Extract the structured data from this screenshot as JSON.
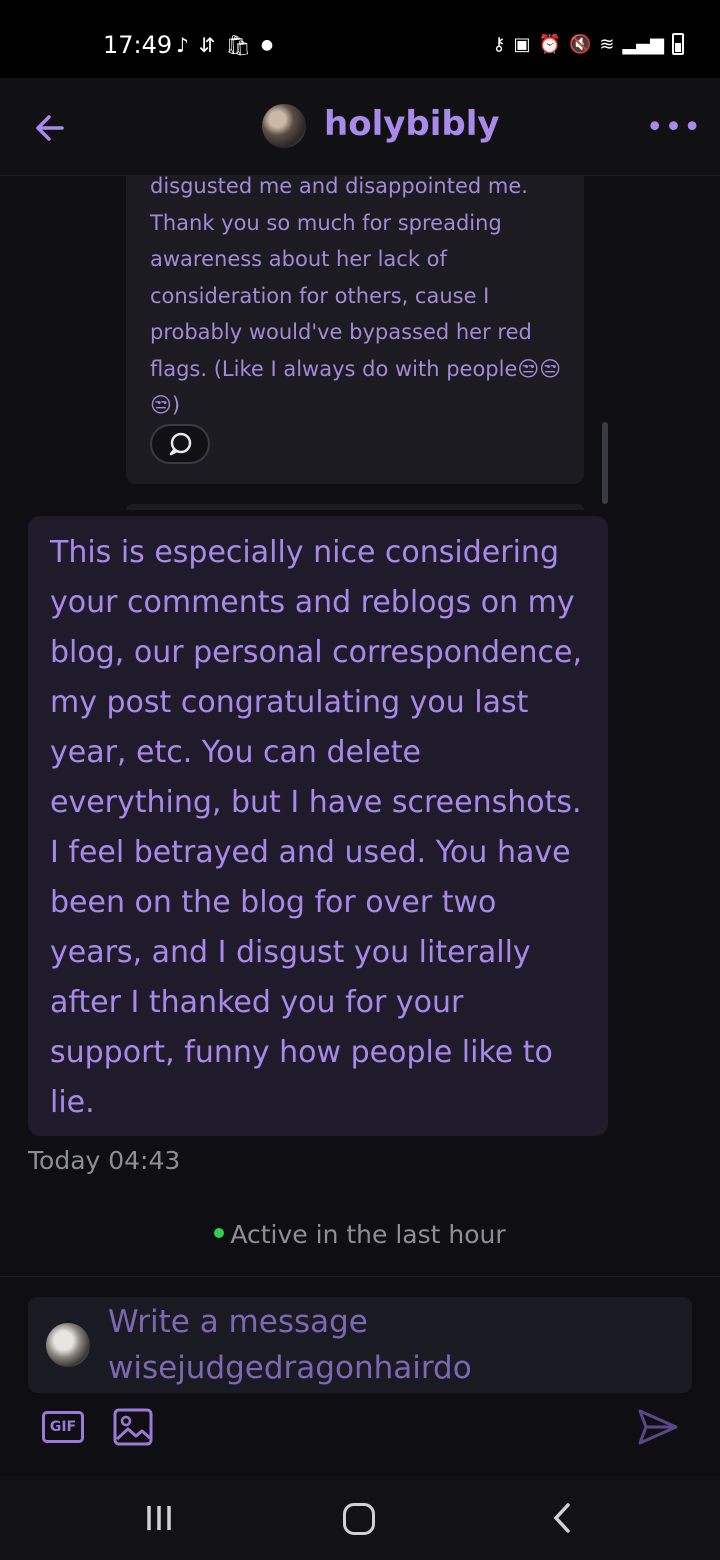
{
  "status_bar": {
    "time": "17:49",
    "left_icons": [
      "tiktok-icon",
      "sync-icon",
      "shopping-bag-icon",
      "dot-icon"
    ],
    "right_icons": [
      "key-icon",
      "lock-icon",
      "alarm-icon",
      "mute-icon",
      "wifi-icon",
      "signal-icon",
      "battery-icon"
    ]
  },
  "header": {
    "title": "holybibly",
    "back_icon": "arrow-left-icon",
    "more_icon": "more-dots-icon"
  },
  "quoted_post": {
    "text": "disgusted me and disappointed me. Thank you so much for spreading awareness about her lack of consideration for others, cause I probably would've bypassed her red flags. (Like I always do with people😒😒😒)"
  },
  "message": {
    "text": "This is especially nice considering your comments and reblogs on my blog, our personal correspondence, my post congratulating you last year, etc. You can delete everything, but I have screenshots. I feel betrayed and used. You have been on the blog for over two years, and I disgust you literally after I thanked you for your support, funny how people like to lie.",
    "time": "Today 04:43"
  },
  "presence": {
    "status": "Active in the last hour"
  },
  "composer": {
    "placeholder": "Write a message wisejudgedragonhairdo",
    "gif_label": "GIF"
  },
  "colors": {
    "accent": "#a989ea",
    "bubble_bg": "#1f1b2a",
    "online_dot": "#2ecf57"
  }
}
